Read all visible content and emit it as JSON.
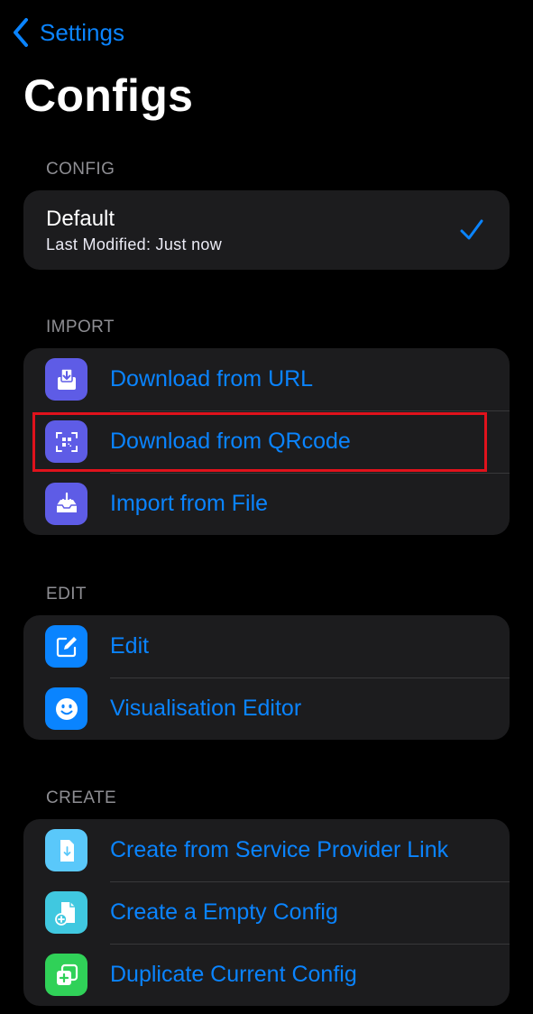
{
  "nav": {
    "back_label": "Settings"
  },
  "title": "Configs",
  "sections": {
    "config": {
      "header": "CONFIG",
      "item": {
        "name": "Default",
        "subtitle": "Last Modified: Just now",
        "selected": true
      }
    },
    "import": {
      "header": "IMPORT",
      "items": [
        {
          "label": "Download from URL",
          "icon": "download-tray-icon",
          "icon_color": "#5e5ce6"
        },
        {
          "label": "Download from QRcode",
          "icon": "qrcode-scan-icon",
          "icon_color": "#5e5ce6"
        },
        {
          "label": "Import from File",
          "icon": "import-tray-icon",
          "icon_color": "#5e5ce6"
        }
      ]
    },
    "edit": {
      "header": "EDIT",
      "items": [
        {
          "label": "Edit",
          "icon": "pencil-square-icon",
          "icon_color": "#0a84ff"
        },
        {
          "label": "Visualisation Editor",
          "icon": "smiley-face-icon",
          "icon_color": "#0a84ff"
        }
      ]
    },
    "create": {
      "header": "CREATE",
      "items": [
        {
          "label": "Create from Service Provider Link",
          "icon": "document-download-icon",
          "icon_color": "#5ac8fa"
        },
        {
          "label": "Create a Empty Config",
          "icon": "new-document-icon",
          "icon_color": "#40c8e0"
        },
        {
          "label": "Duplicate Current Config",
          "icon": "duplicate-icon",
          "icon_color": "#30d158"
        }
      ]
    }
  },
  "colors": {
    "accent": "#0a84ff",
    "highlight": "#e0121c",
    "background": "#000000",
    "group_background": "#1c1c1e"
  }
}
